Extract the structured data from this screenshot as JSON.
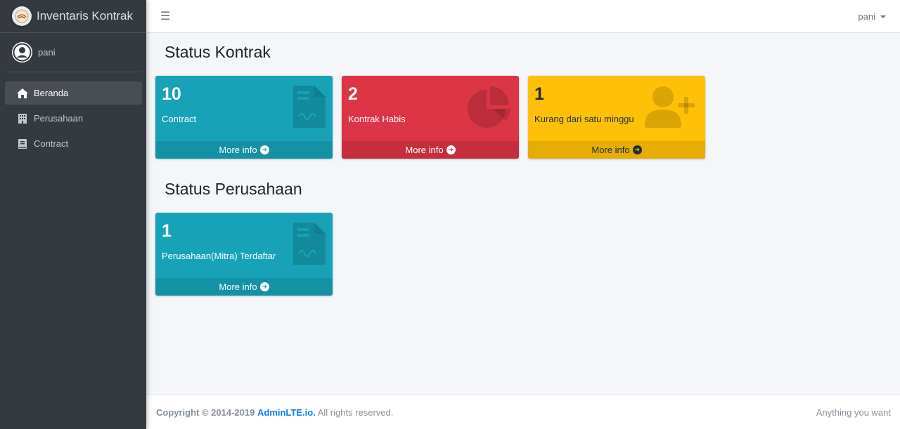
{
  "brand": {
    "title": "Inventaris Kontrak"
  },
  "user": {
    "name": "pani"
  },
  "sidebar": {
    "items": [
      {
        "label": "Beranda",
        "icon": "home-icon",
        "active": true
      },
      {
        "label": "Perusahaan",
        "icon": "building-icon",
        "active": false
      },
      {
        "label": "Contract",
        "icon": "book-icon",
        "active": false
      }
    ]
  },
  "topbar": {
    "user_label": "pani"
  },
  "sections": {
    "kontrak_title": "Status Kontrak",
    "perusahaan_title": "Status Perusahaan"
  },
  "boxes": {
    "contract": {
      "count": "10",
      "label": "Contract",
      "more": "More info",
      "icon": "file-contract-icon",
      "color": "#17a2b8"
    },
    "habis": {
      "count": "2",
      "label": "Kontrak Habis",
      "more": "More info",
      "icon": "pie-chart-icon",
      "color": "#dc3545"
    },
    "minggu": {
      "count": "1",
      "label": "Kurang dari satu minggu",
      "more": "More info",
      "icon": "user-plus-icon",
      "color": "#ffc107"
    },
    "mitra": {
      "count": "1",
      "label": "Perusahaan(Mitra) Terdaftar",
      "more": "More info",
      "icon": "file-contract-icon",
      "color": "#17a2b8"
    }
  },
  "footer": {
    "copyright": "Copyright © 2014-2019",
    "link": "AdminLTE.io.",
    "rights": "All rights reserved.",
    "right_text": "Anything you want"
  }
}
